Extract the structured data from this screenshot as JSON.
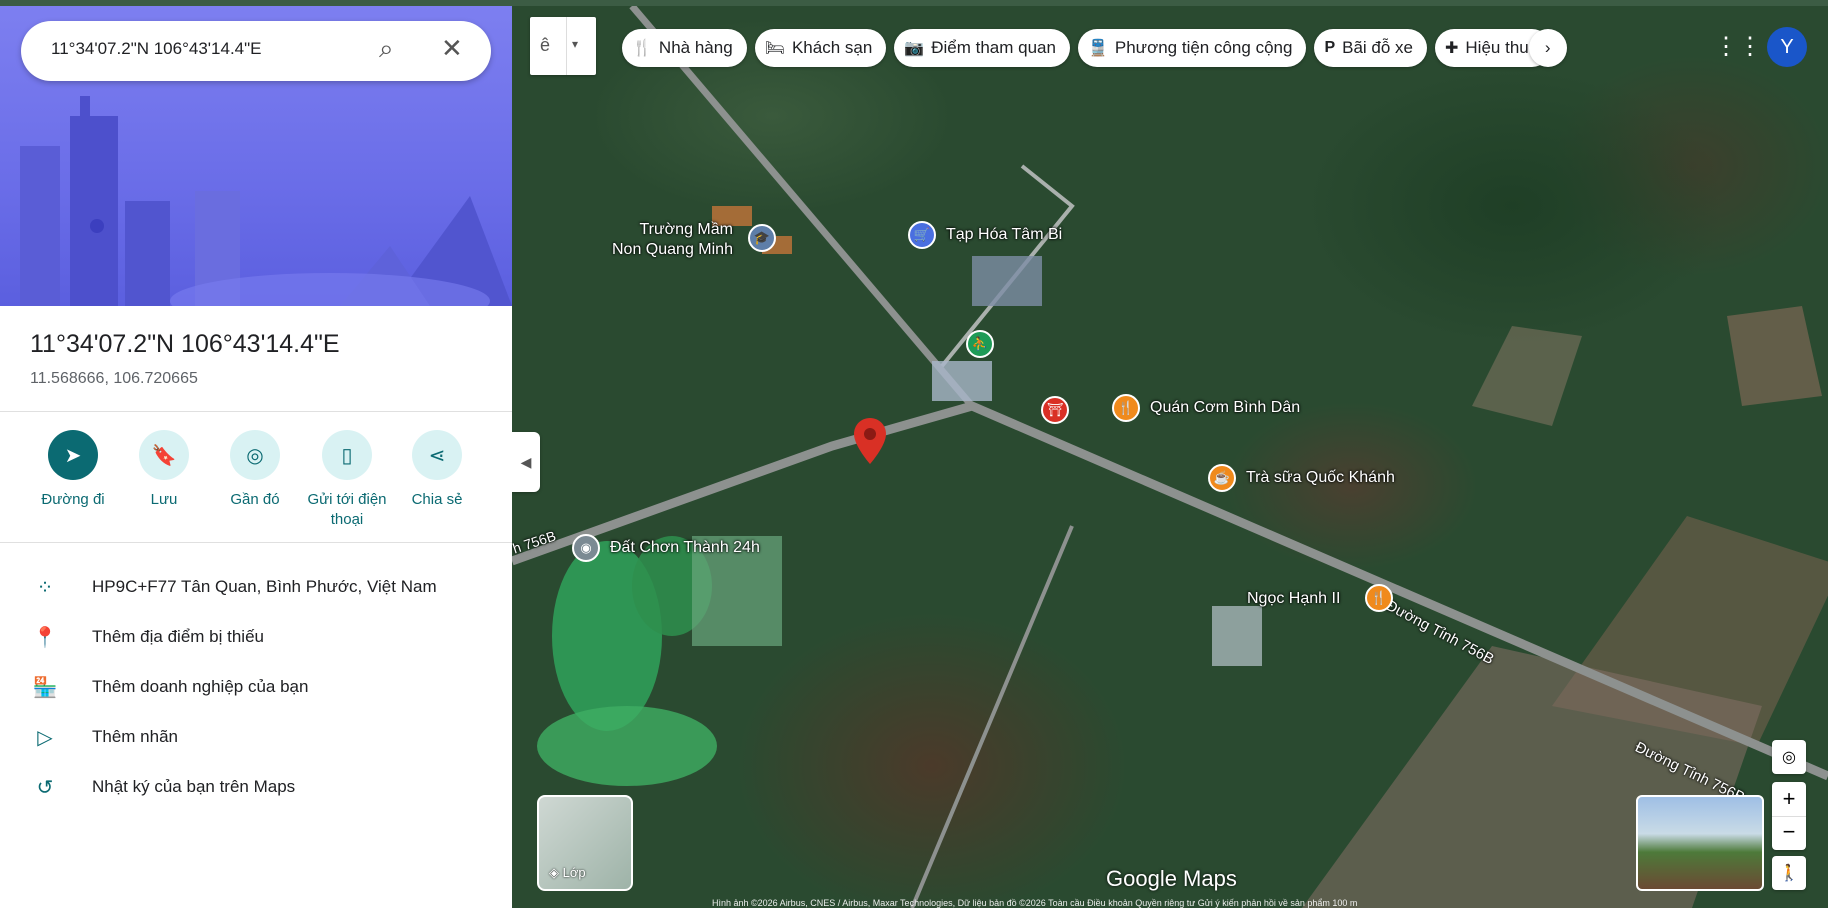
{
  "search": {
    "query": "11°34'07.2\"N 106°43'14.4\"E"
  },
  "place": {
    "title": "11°34'07.2\"N 106°43'14.4\"E",
    "decimal": "11.568666, 106.720665"
  },
  "actions": [
    {
      "label": "Đường đi",
      "icon": "directions-icon"
    },
    {
      "label": "Lưu",
      "icon": "bookmark-icon"
    },
    {
      "label": "Gần đó",
      "icon": "nearby-icon"
    },
    {
      "label": "Gửi tới điện thoại",
      "icon": "send-to-phone-icon"
    },
    {
      "label": "Chia sẻ",
      "icon": "share-icon"
    }
  ],
  "details": [
    {
      "text": "HP9C+F77 Tân Quan, Bình Phước, Việt Nam",
      "icon": "plus-code-icon"
    },
    {
      "text": "Thêm địa điểm bị thiếu",
      "icon": "add-location-icon"
    },
    {
      "text": "Thêm doanh nghiệp của bạn",
      "icon": "add-business-icon"
    },
    {
      "text": "Thêm nhãn",
      "icon": "label-icon"
    },
    {
      "text": "Nhật ký của bạn trên Maps",
      "icon": "history-icon"
    }
  ],
  "chips": [
    {
      "label": "Nhà hàng",
      "icon": "restaurant-icon",
      "glyph": "🍴"
    },
    {
      "label": "Khách sạn",
      "icon": "hotel-icon",
      "glyph": "🛏"
    },
    {
      "label": "Điểm tham quan",
      "icon": "camera-icon",
      "glyph": "📷"
    },
    {
      "label": "Phương tiện công cộng",
      "icon": "transit-icon",
      "glyph": "🚆"
    },
    {
      "label": "Bãi đỗ xe",
      "icon": "parking-icon",
      "glyph": "P"
    },
    {
      "label": "Hiệu thuốc",
      "icon": "pharmacy-icon",
      "glyph": "✚"
    }
  ],
  "map": {
    "pois": [
      {
        "name": "Trường Mầm\nNon Quang Minh",
        "icon": "school-icon",
        "color": "#5e7ea8"
      },
      {
        "name": "Tạp Hóa Tâm Bi",
        "icon": "shopping-cart-icon",
        "color": "#4a6fe0"
      },
      {
        "name": "Quán Cơm Bình Dân",
        "icon": "restaurant-icon",
        "color": "#f08a1c"
      },
      {
        "name": "Trà sữa Quốc Khánh",
        "icon": "cafe-icon",
        "color": "#f08a1c"
      },
      {
        "name": "Ngọc Hạnh II",
        "icon": "restaurant-icon",
        "color": "#f08a1c"
      },
      {
        "name": "Đất Chơn Thành 24h",
        "icon": "place-icon",
        "color": "#7b8a93"
      }
    ],
    "roads": [
      "Đường Tỉnh 756B",
      "Đường Tỉnh 756B",
      "h 756B"
    ],
    "layer_label": "Lớp",
    "wordmark": "Google Maps",
    "footer": "Hình ảnh ©2026 Airbus, CNES / Airbus, Maxar Technologies, Dữ liệu bản đồ ©2026   Toàn cầu   Điều khoản   Quyền riêng tư   Gửi ý kiến phản hồi về sản phẩm   100 m"
  },
  "user": {
    "initial": "Y"
  },
  "colors": {
    "accent": "#0b6a72",
    "pin": "#d93025",
    "avatar": "#1a56c9"
  }
}
